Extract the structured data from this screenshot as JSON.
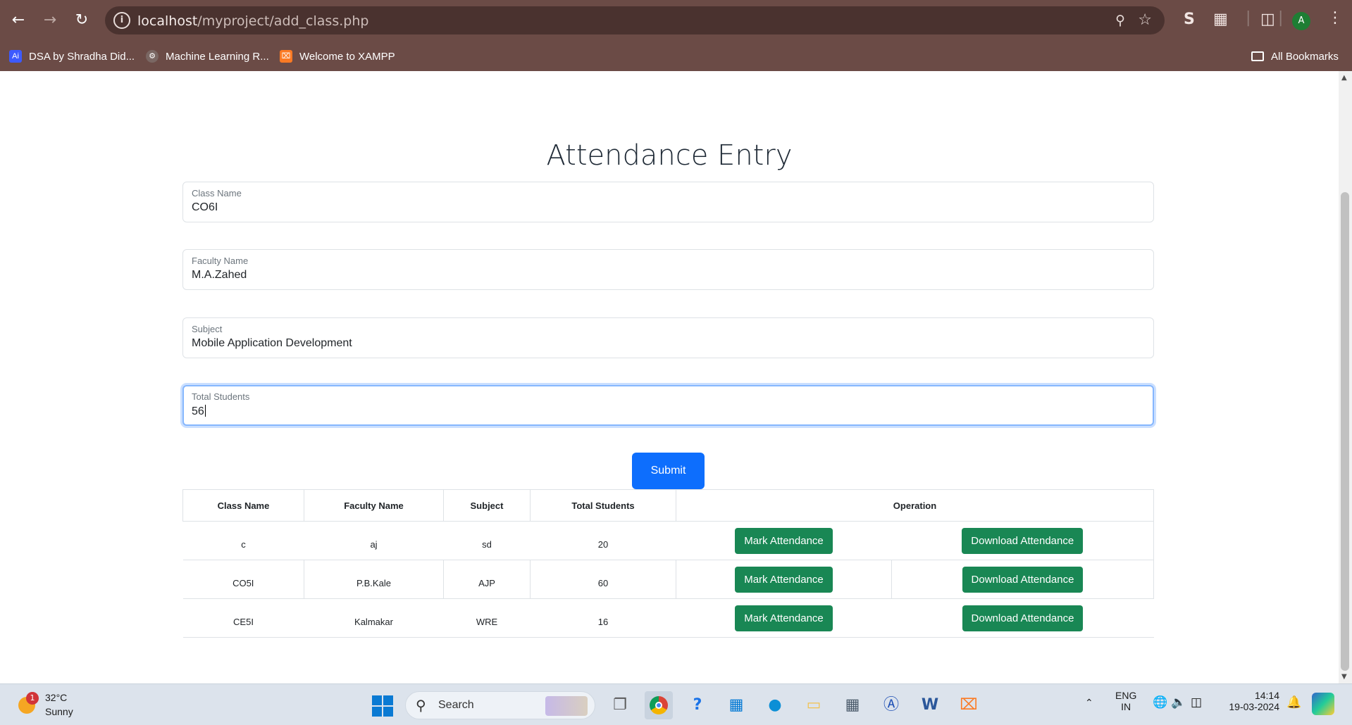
{
  "browser": {
    "url_host": "localhost",
    "url_path": "/myproject/add_class.php",
    "bookmarks": [
      {
        "label": "DSA by Shradha Did...",
        "icon": "apna-college-icon"
      },
      {
        "label": "Machine Learning R...",
        "icon": "gear-icon"
      },
      {
        "label": "Welcome to XAMPP",
        "icon": "xampp-icon"
      }
    ],
    "all_bookmarks_label": "All Bookmarks",
    "profile_initial": "A"
  },
  "page": {
    "title": "Attendance Entry",
    "form": {
      "class_name": {
        "label": "Class Name",
        "value": "CO6I"
      },
      "faculty_name": {
        "label": "Faculty Name",
        "value": "M.A.Zahed"
      },
      "subject": {
        "label": "Subject",
        "value": "Mobile Application Development"
      },
      "total_students": {
        "label": "Total Students",
        "value": "56"
      }
    },
    "submit_label": "Submit",
    "table": {
      "headers": [
        "Class Name",
        "Faculty Name",
        "Subject",
        "Total Students",
        "Operation"
      ],
      "mark_label": "Mark Attendance",
      "download_label": "Download Attendance",
      "rows": [
        {
          "class_name": "c",
          "faculty": "aj",
          "subject": "sd",
          "total": "20"
        },
        {
          "class_name": "CO5I",
          "faculty": "P.B.Kale",
          "subject": "AJP",
          "total": "60"
        },
        {
          "class_name": "CE5I",
          "faculty": "Kalmakar",
          "subject": "WRE",
          "total": "16"
        }
      ]
    }
  },
  "taskbar": {
    "weather_badge": "1",
    "temperature": "32°C",
    "condition": "Sunny",
    "search_label": "Search",
    "language": "ENG",
    "region": "IN",
    "time": "14:14",
    "date": "19-03-2024"
  },
  "colors": {
    "primary": "#0d6efd",
    "success": "#198754",
    "chrome": "#6b4b46"
  }
}
